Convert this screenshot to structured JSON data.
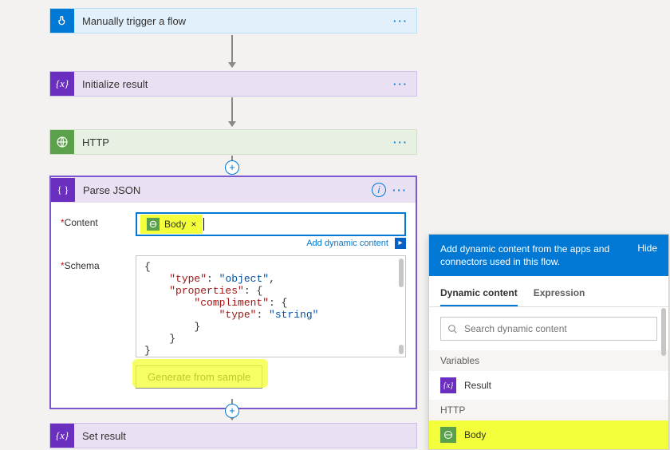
{
  "flow": {
    "trigger": {
      "title": "Manually trigger a flow"
    },
    "init": {
      "title": "Initialize result"
    },
    "http": {
      "title": "HTTP"
    },
    "parse": {
      "title": "Parse JSON"
    },
    "setres": {
      "title": "Set result"
    }
  },
  "parse": {
    "content_label": "Content",
    "schema_label": "Schema",
    "required_marker": "*",
    "token": {
      "label": "Body",
      "close": "×"
    },
    "adc_link": "Add dynamic content",
    "generate_btn": "Generate from sample",
    "schema": {
      "line1a": "\"type\"",
      "line1b": "\"object\"",
      "line2a": "\"properties\"",
      "line3a": "\"compliment\"",
      "line4a": "\"type\"",
      "line4b": "\"string\""
    }
  },
  "dcp": {
    "heading": "Add dynamic content from the apps and connectors used in this flow.",
    "hide": "Hide",
    "tab_dynamic": "Dynamic content",
    "tab_expression": "Expression",
    "search_placeholder": "Search dynamic content",
    "sec_variables": "Variables",
    "item_result": "Result",
    "sec_http": "HTTP",
    "item_body": "Body"
  }
}
